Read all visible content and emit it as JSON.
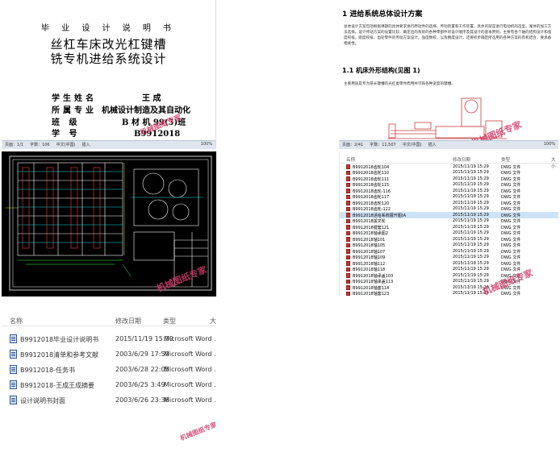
{
  "cover": {
    "heading": "毕 业 设 计 说 明 书",
    "title_line1": "丝杠车床改光杠键槽",
    "title_line2": "铣专机进给系统设计",
    "fields": [
      {
        "key": "学生姓名",
        "val": "王 成"
      },
      {
        "key": "所属专业",
        "val": "机械设计制造及其自动化"
      },
      {
        "key": "班 级",
        "val": "B 材 机 99(5)班"
      },
      {
        "key": "学 号",
        "val": "B9912018"
      }
    ],
    "status": [
      "页面：1/1",
      "字数：106",
      "中文(中国)",
      "插入",
      "100%"
    ]
  },
  "doc": {
    "heading": "1  进给系统总体设计方案",
    "para1": "总体设计方案包括根据课题的具体要求进行原动件的选择、传动装置和工作装置，具体的就是进行电动机的选型。尾体的加工方法选择。设计传动方案的设置比较、确定出的系统的各种零部件的设计顺序及其设计的基本原则，主要有各个轴的结构设计和强度校核。刚度校核，齿轮零件的传动方案设计，强度数校，以及精度设计，还要初步确定所选用的各种方案的有机结合，要具备相关性。",
    "subheading": "1.1  机床外形结构(见图 1)",
    "para2": "主要用途是专为铣长键槽的光杠类零件而用并可铣各种宽度的键槽。",
    "status": [
      "页面：2/41",
      "字数：11,507",
      "中文(中国)",
      "插入",
      "100%"
    ]
  },
  "dwg_list": {
    "col_name": "名称",
    "col_date": "修改日期",
    "col_type": "类型",
    "col_size": "大小",
    "files": [
      {
        "name": "B9912018齿轮104",
        "date": "2015/11/19 15:29",
        "type": "DWG 文件"
      },
      {
        "name": "B9912018齿轮110",
        "date": "2015/11/19 15:29",
        "type": "DWG 文件"
      },
      {
        "name": "B9912018齿轮111",
        "date": "2015/11/19 15:29",
        "type": "DWG 文件"
      },
      {
        "name": "B9912018齿轮115",
        "date": "2015/11/19 15:29",
        "type": "DWG 文件"
      },
      {
        "name": "B9912018齿轮-116",
        "date": "2015/11/19 15:29",
        "type": "DWG 文件"
      },
      {
        "name": "B9912018齿轮117",
        "date": "2015/11/19 15:29",
        "type": "DWG 文件"
      },
      {
        "name": "B9912018齿轮120",
        "date": "2015/11/19 15:29",
        "type": "DWG 文件"
      },
      {
        "name": "B9912018齿轮-122",
        "date": "2015/11/19 15:29",
        "type": "DWG 文件"
      },
      {
        "name": "B9912018进给系统展开图(A",
        "date": "2015/11/19 15:29",
        "type": "DWG 文件"
      },
      {
        "name": "B9912018拔叉轮",
        "date": "2015/11/19 15:29",
        "type": "DWG 文件"
      },
      {
        "name": "B9912018键套121",
        "date": "2015/11/19 15:29",
        "type": "DWG 文件"
      },
      {
        "name": "B9912018轴承图2",
        "date": "2015/11/19 15:29",
        "type": "DWG 文件"
      },
      {
        "name": "B9912018轴101",
        "date": "2015/11/19 15:29",
        "type": "DWG 文件"
      },
      {
        "name": "B9912018轴105",
        "date": "2015/11/19 15:29",
        "type": "DWG 文件"
      },
      {
        "name": "B9912018轴107",
        "date": "2015/11/19 15:29",
        "type": "DWG 文件"
      },
      {
        "name": "B9912018轴109",
        "date": "2015/11/19 15:29",
        "type": "DWG 文件"
      },
      {
        "name": "B9912018轴112",
        "date": "2015/11/19 15:29",
        "type": "DWG 文件"
      },
      {
        "name": "B9912018轴118",
        "date": "2015/11/19 15:29",
        "type": "DWG 文件"
      },
      {
        "name": "B9912018轴承盖103",
        "date": "2015/11/19 15:29",
        "type": "DWG 文件"
      },
      {
        "name": "B9912018轴承盖113",
        "date": "2015/11/19 15:29",
        "type": "DWG 文件"
      },
      {
        "name": "B9912018轴套114",
        "date": "2015/11/19 15:29",
        "type": "DWG 文件"
      },
      {
        "name": "B9912018轴套123",
        "date": "2015/11/19 15:29",
        "type": "DWG 文件"
      }
    ],
    "selected_index": 8
  },
  "doc_list": {
    "col_name": "名称",
    "col_date": "修改日期",
    "col_type": "类型",
    "col_size": "大",
    "files": [
      {
        "name": "B9912018毕业设计说明书",
        "date": "2015/11/19 15:30",
        "type": "Microsoft Word ..."
      },
      {
        "name": "B9912018清单和参考文献",
        "date": "2003/6/29 17:59",
        "type": "Microsoft Word ..."
      },
      {
        "name": "B9912018-任务书",
        "date": "2003/6/28 22:05",
        "type": "Microsoft Word ..."
      },
      {
        "name": "B9912018-王成王成摘要",
        "date": "2003/6/25 3:49",
        "type": "Microsoft Word ..."
      },
      {
        "name": "设计说明书封面",
        "date": "2003/6/26 23:36",
        "type": "Microsoft Word ..."
      }
    ]
  },
  "watermark": "机械图纸专家",
  "colors": {
    "watermark": "#d23a6a",
    "selection": "#cfe3f8",
    "word_blue": "#2b579a",
    "dwg_red": "#c8362e"
  }
}
